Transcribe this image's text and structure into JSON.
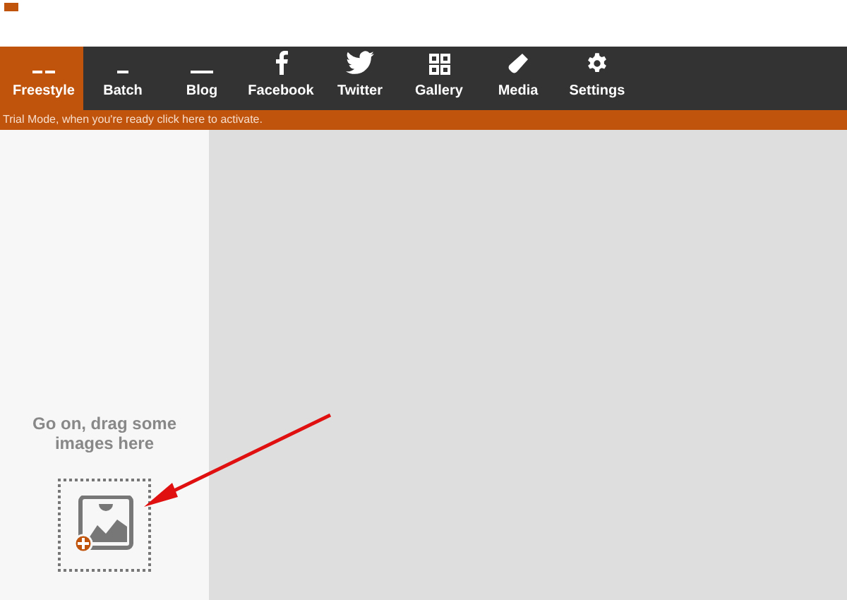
{
  "tabs": [
    {
      "label": "Freestyle",
      "selected": true
    },
    {
      "label": "Batch",
      "selected": false
    },
    {
      "label": "Blog",
      "selected": false
    },
    {
      "label": "Facebook",
      "selected": false
    },
    {
      "label": "Twitter",
      "selected": false
    },
    {
      "label": "Gallery",
      "selected": false
    },
    {
      "label": "Media",
      "selected": false
    },
    {
      "label": "Settings",
      "selected": false
    }
  ],
  "banner": {
    "text": "Trial Mode, when you're ready click here to activate."
  },
  "sidebar": {
    "hint": "Go on, drag some images here"
  }
}
